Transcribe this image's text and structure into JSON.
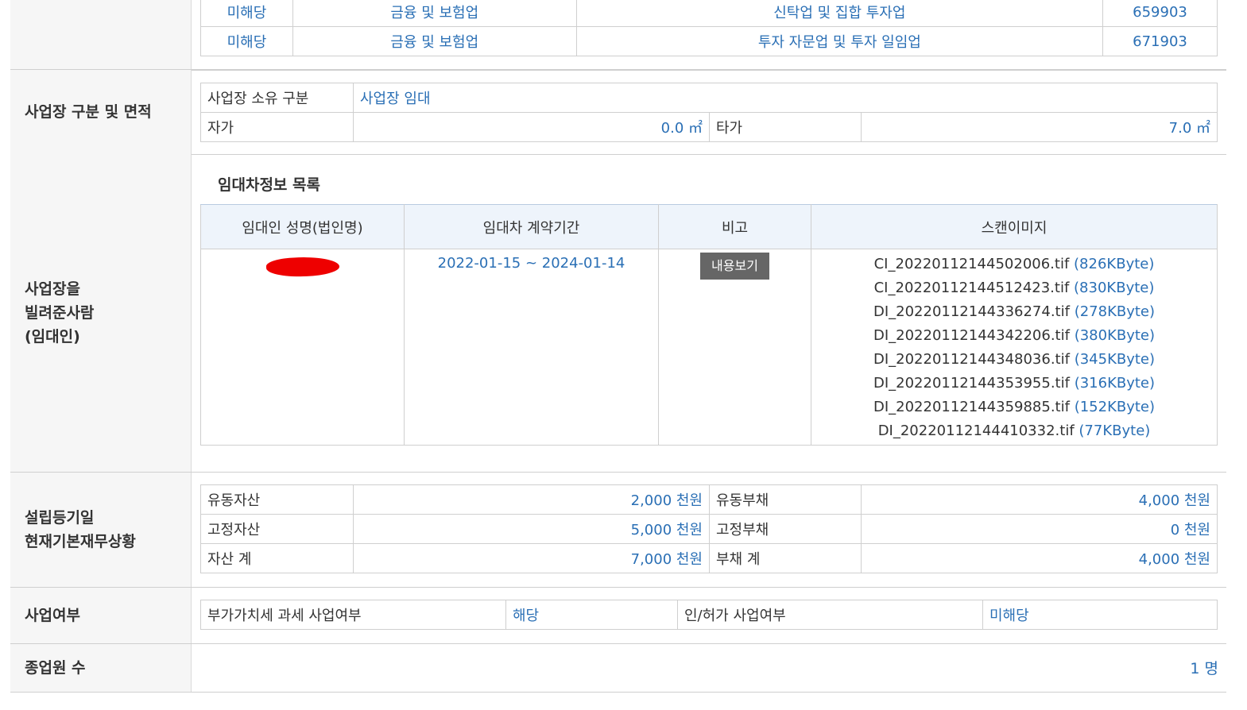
{
  "industry_rows": [
    {
      "status": "미해당",
      "category": "금융 및 보험업",
      "detail": "신탁업 및 집합 투자업",
      "code": "659903"
    },
    {
      "status": "미해당",
      "category": "금융 및 보험업",
      "detail": "투자 자문업 및 투자 일임업",
      "code": "671903"
    }
  ],
  "premises": {
    "header": "사업장 구분 및 면적",
    "ownership_label": "사업장 소유 구분",
    "ownership_value": "사업장 임대",
    "own_label": "자가",
    "own_value": "0.0 ㎡",
    "other_label": "타가",
    "other_value": "7.0 ㎡"
  },
  "lessor": {
    "header_lines": [
      "사업장을",
      "빌려준사람",
      "(임대인)"
    ],
    "list_title": "임대차정보 목록",
    "columns": [
      "임대인 성명(법인명)",
      "임대차 계약기간",
      "비고",
      "스캔이미지"
    ],
    "period": "2022-01-15 ~ 2024-01-14",
    "view_button": "내용보기",
    "files": [
      {
        "name": "CI_20220112144502006.tif",
        "size": "(826KByte)"
      },
      {
        "name": "CI_20220112144512423.tif",
        "size": "(830KByte)"
      },
      {
        "name": "DI_20220112144336274.tif",
        "size": "(278KByte)"
      },
      {
        "name": "DI_20220112144342206.tif",
        "size": "(380KByte)"
      },
      {
        "name": "DI_20220112144348036.tif",
        "size": "(345KByte)"
      },
      {
        "name": "DI_20220112144353955.tif",
        "size": "(316KByte)"
      },
      {
        "name": "DI_20220112144359885.tif",
        "size": "(152KByte)"
      },
      {
        "name": "DI_20220112144410332.tif",
        "size": "(77KByte)"
      }
    ]
  },
  "finance": {
    "header_lines": [
      "설립등기일",
      "현재기본재무상황"
    ],
    "rows": [
      {
        "l1": "유동자산",
        "v1": "2,000 천원",
        "l2": "유동부채",
        "v2": "4,000 천원"
      },
      {
        "l1": "고정자산",
        "v1": "5,000 천원",
        "l2": "고정부채",
        "v2": "0 천원"
      },
      {
        "l1": "자산 계",
        "v1": "7,000 천원",
        "l2": "부채 계",
        "v2": "4,000 천원"
      }
    ]
  },
  "business": {
    "header": "사업여부",
    "vat_label": "부가가치세 과세 사업여부",
    "vat_value": "해당",
    "license_label": "인/허가 사업여부",
    "license_value": "미해당"
  },
  "employees": {
    "header": "종업원 수",
    "value": "1 명"
  }
}
